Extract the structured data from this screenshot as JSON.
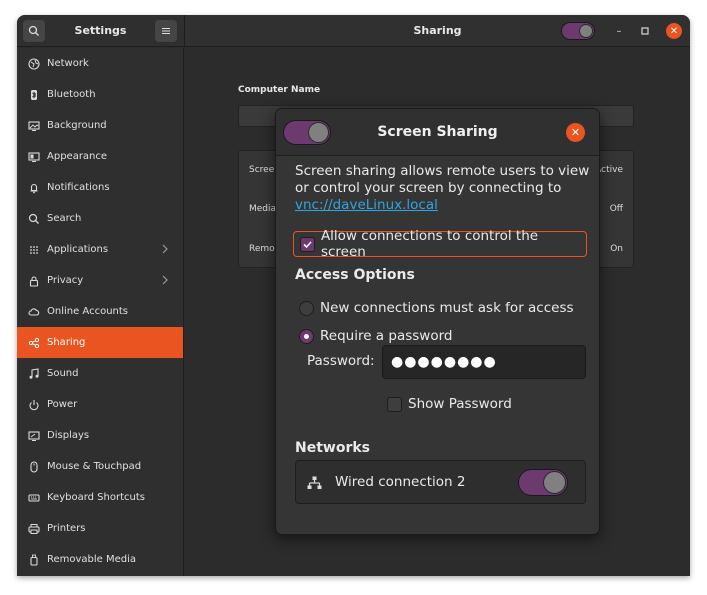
{
  "window": {
    "settings_title": "Settings",
    "panel_title": "Sharing",
    "sharing_enabled": true,
    "accent_color": "#e95420",
    "toggle_color": "#6c3a6e"
  },
  "sidebar": {
    "items": [
      {
        "label": "Network",
        "icon": "network-icon"
      },
      {
        "label": "Bluetooth",
        "icon": "bluetooth-icon"
      },
      {
        "label": "Background",
        "icon": "background-icon"
      },
      {
        "label": "Appearance",
        "icon": "appearance-icon"
      },
      {
        "label": "Notifications",
        "icon": "bell-icon"
      },
      {
        "label": "Search",
        "icon": "search-icon"
      },
      {
        "label": "Applications",
        "icon": "grid-icon"
      },
      {
        "label": "Privacy",
        "icon": "lock-icon"
      },
      {
        "label": "Online Accounts",
        "icon": "cloud-icon"
      },
      {
        "label": "Sharing",
        "icon": "share-icon",
        "active": true
      },
      {
        "label": "Sound",
        "icon": "music-note-icon"
      },
      {
        "label": "Power",
        "icon": "power-icon"
      },
      {
        "label": "Displays",
        "icon": "display-icon"
      },
      {
        "label": "Mouse & Touchpad",
        "icon": "mouse-icon"
      },
      {
        "label": "Keyboard Shortcuts",
        "icon": "keyboard-icon"
      },
      {
        "label": "Printers",
        "icon": "printer-icon"
      },
      {
        "label": "Removable Media",
        "icon": "usb-icon"
      }
    ]
  },
  "main": {
    "computer_name_label": "Computer Name",
    "computer_name_value": "",
    "rows": [
      {
        "label": "Scree",
        "status": "Active"
      },
      {
        "label": "Media",
        "status": "Off"
      },
      {
        "label": "Remo",
        "status": "On"
      }
    ]
  },
  "dialog": {
    "title": "Screen Sharing",
    "enabled": true,
    "description": "Screen sharing allows remote users to view or control your screen by connecting to",
    "vnc_link": "vnc://daveLinux.local",
    "allow_control_label": "Allow connections to control the screen",
    "allow_control_checked": true,
    "access_options_heading": "Access Options",
    "option_ask": "New connections must ask for access",
    "option_password": "Require a password",
    "selected_option": "password",
    "password_label": "Password:",
    "password_value": "●●●●●●●●",
    "show_password_label": "Show Password",
    "show_password_checked": false,
    "networks_heading": "Networks",
    "network_name": "Wired connection 2",
    "network_enabled": true
  }
}
